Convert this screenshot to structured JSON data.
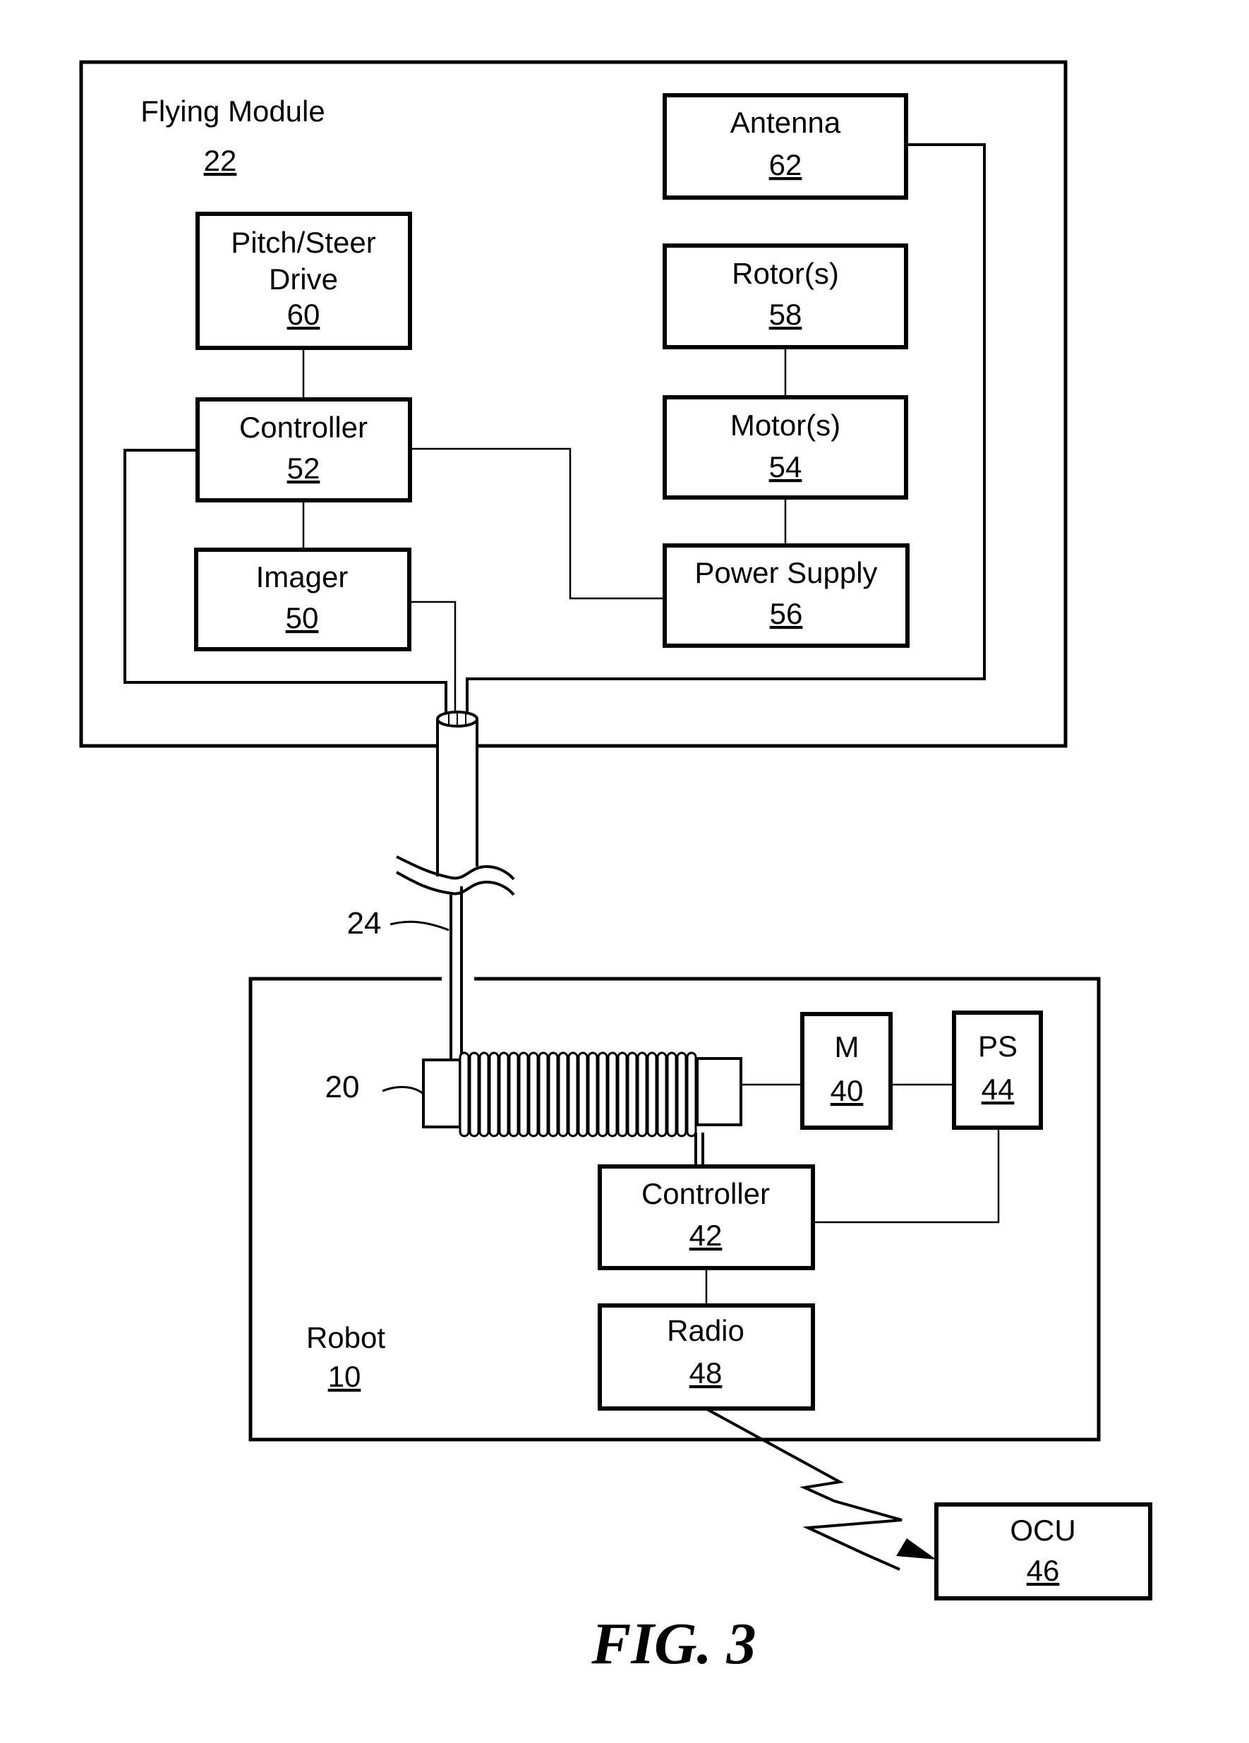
{
  "figure": {
    "caption": "FIG. 3"
  },
  "flying_module": {
    "title": "Flying Module",
    "number": "22",
    "blocks": {
      "antenna": {
        "label": "Antenna",
        "number": "62"
      },
      "pitch_steer": {
        "label_line1": "Pitch/Steer",
        "label_line2": "Drive",
        "number": "60"
      },
      "rotors": {
        "label": "Rotor(s)",
        "number": "58"
      },
      "controller": {
        "label": "Controller",
        "number": "52"
      },
      "motors": {
        "label": "Motor(s)",
        "number": "54"
      },
      "imager": {
        "label": "Imager",
        "number": "50"
      },
      "power_supply": {
        "label": "Power Supply",
        "number": "56"
      }
    }
  },
  "tether": {
    "number": "24"
  },
  "spool": {
    "number": "20"
  },
  "robot": {
    "title": "Robot",
    "number": "10",
    "blocks": {
      "motor": {
        "label": "M",
        "number": "40"
      },
      "power_supply": {
        "label": "PS",
        "number": "44"
      },
      "controller": {
        "label": "Controller",
        "number": "42"
      },
      "radio": {
        "label": "Radio",
        "number": "48"
      }
    }
  },
  "ocu": {
    "label": "OCU",
    "number": "46"
  },
  "connections": [
    [
      "pitch_steer_60",
      "controller_52"
    ],
    [
      "controller_52",
      "imager_50"
    ],
    [
      "controller_52",
      "power_supply_56"
    ],
    [
      "rotors_58",
      "motors_54"
    ],
    [
      "motors_54",
      "power_supply_56"
    ],
    [
      "antenna_62",
      "tether_24"
    ],
    [
      "controller_52",
      "tether_24"
    ],
    [
      "imager_50",
      "tether_24"
    ],
    [
      "tether_24",
      "spool_20"
    ],
    [
      "spool_20",
      "motor_40"
    ],
    [
      "motor_40",
      "power_supply_44"
    ],
    [
      "spool_20",
      "controller_42"
    ],
    [
      "power_supply_44",
      "controller_42"
    ],
    [
      "controller_42",
      "radio_48"
    ],
    [
      "radio_48",
      "ocu_46"
    ]
  ]
}
